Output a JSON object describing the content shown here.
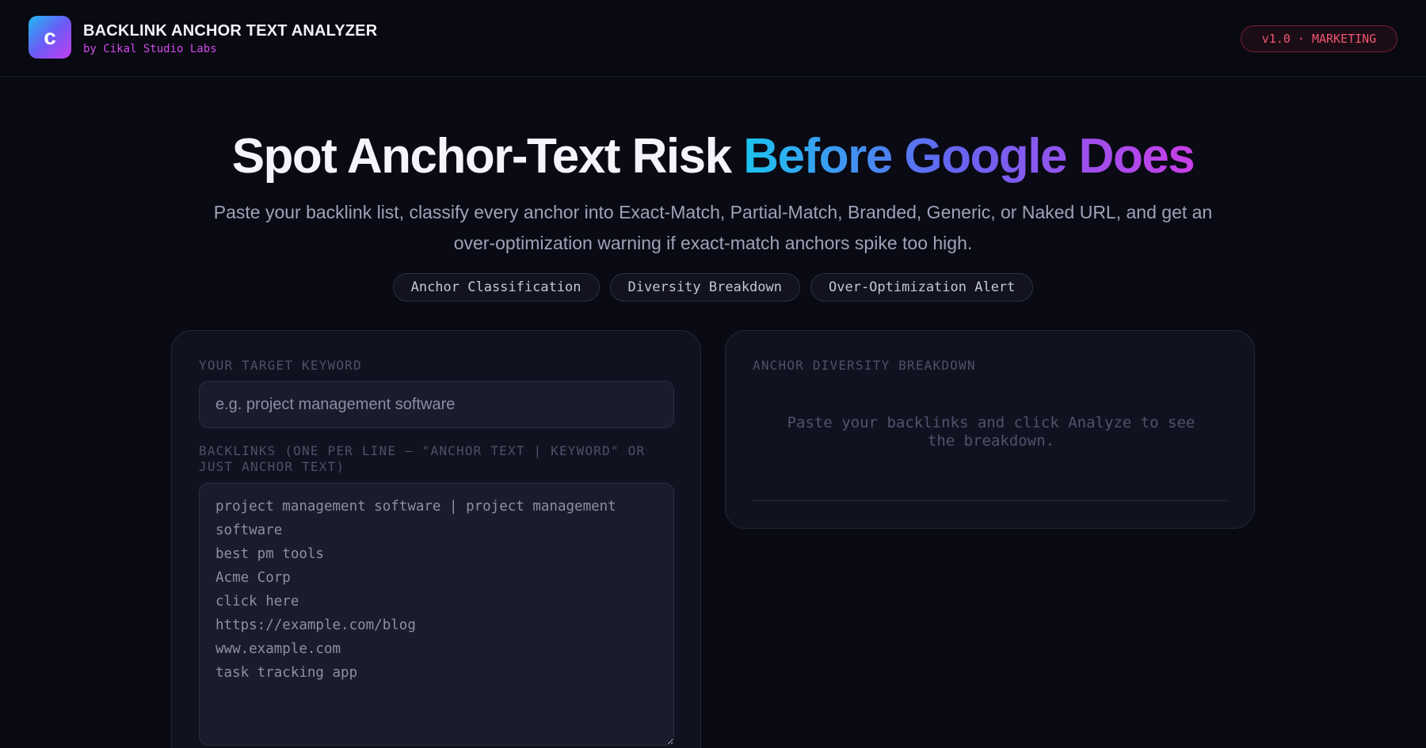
{
  "header": {
    "logo_letter": "c",
    "title": "BACKLINK ANCHOR TEXT ANALYZER",
    "subtitle": "by Cikal Studio Labs",
    "version_badge": "v1.0 · MARKETING"
  },
  "hero": {
    "title_plain": "Spot Anchor-Text Risk ",
    "title_gradient": "Before Google Does",
    "description": "Paste your backlink list, classify every anchor into Exact-Match, Partial-Match, Branded, Generic, or Naked URL, and get an over-optimization warning if exact-match anchors spike too high.",
    "tags": [
      "Anchor Classification",
      "Diversity Breakdown",
      "Over-Optimization Alert"
    ]
  },
  "input_panel": {
    "keyword_label": "YOUR TARGET KEYWORD",
    "keyword_placeholder": "e.g. project management software",
    "keyword_value": "",
    "backlinks_label": "BACKLINKS (ONE PER LINE — \"ANCHOR TEXT | KEYWORD\" OR JUST ANCHOR TEXT)",
    "backlinks_placeholder": "project management software | project management software\nbest pm tools\nAcme Corp\nclick here\nhttps://example.com/blog\nwww.example.com\ntask tracking app"
  },
  "result_panel": {
    "title": "ANCHOR DIVERSITY BREAKDOWN",
    "empty_message": "Paste your backlinks and click Analyze to see the breakdown."
  },
  "colors": {
    "background": "#0a0a14",
    "accent_gradient_start": "#1cc4f0",
    "accent_gradient_mid": "#6366f1",
    "accent_gradient_end": "#c93ee8",
    "badge_red": "#f0566f",
    "subtitle_magenta": "#d04be6"
  }
}
